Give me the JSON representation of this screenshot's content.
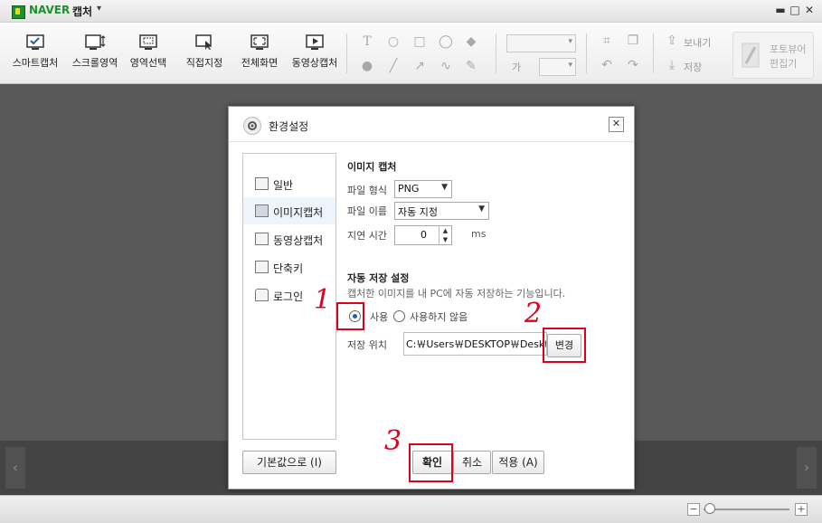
{
  "titlebar": {
    "brand": "NAVER",
    "app_name": "캡처",
    "menu_arrow": "▾",
    "minimize": "▬",
    "maximize": "□",
    "close": "✕"
  },
  "toolbar": {
    "capture_modes": [
      {
        "label": "스마트캡처",
        "icon": "smart-capture-icon"
      },
      {
        "label": "스크롤영역",
        "icon": "scroll-capture-icon"
      },
      {
        "label": "영역선택",
        "icon": "region-select-icon"
      },
      {
        "label": "직접지정",
        "icon": "direct-select-icon"
      },
      {
        "label": "전체화면",
        "icon": "fullscreen-icon"
      },
      {
        "label": "동영상캡처",
        "icon": "video-capture-icon"
      }
    ],
    "text_tool": "T",
    "font_size_label": "가",
    "share_label": "보내기",
    "save_label": "저장",
    "photo_editor_line1": "포토뷰어",
    "photo_editor_line2": "편집기"
  },
  "dialog": {
    "title": "환경설정",
    "close": "✕",
    "nav": [
      {
        "label": "일반",
        "icon": "general-icon"
      },
      {
        "label": "이미지캡처",
        "icon": "image-capture-icon"
      },
      {
        "label": "동영상캡처",
        "icon": "video-capture-icon"
      },
      {
        "label": "단축키",
        "icon": "shortcut-icon"
      },
      {
        "label": "로그인",
        "icon": "lock-icon"
      }
    ],
    "active_nav": "이미지캡처",
    "image_capture": {
      "section_title": "이미지 캡처",
      "file_format_label": "파일 형식",
      "file_format_value": "PNG",
      "file_name_label": "파일 이름",
      "file_name_value": "자동 지정",
      "delay_label": "지연 시간",
      "delay_value": "0",
      "delay_unit": "ms"
    },
    "auto_save": {
      "section_title": "자동 저장 설정",
      "description": "캡처한 이미지를 내 PC에 자동 저장하는 기능입니다.",
      "option_use": "사용",
      "option_not_use": "사용하지 않음",
      "selected": "사용",
      "location_label": "저장 위치",
      "location_value": "C:￦Users￦DESKTOP￦Desktop",
      "change_button": "변경"
    },
    "buttons": {
      "reset": "기본값으로 (I)",
      "ok": "확인",
      "cancel": "취소",
      "apply": "적용 (A)"
    }
  },
  "annotations": {
    "step1": "1",
    "step2": "2",
    "step3": "3",
    "color": "#e0001b"
  },
  "statusbar": {
    "zoom_minus": "−",
    "zoom_plus": "+"
  },
  "nav_arrows": {
    "left": "‹",
    "right": "›"
  }
}
